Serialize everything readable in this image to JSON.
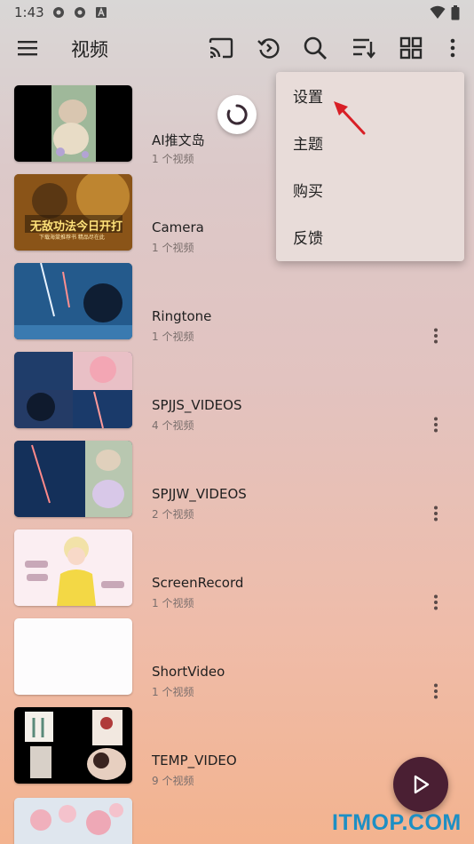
{
  "status_bar": {
    "time": "1:43",
    "icons": [
      "settings-gear-icon",
      "settings-gear-icon",
      "a-badge-icon"
    ],
    "right_icons": [
      "wifi-icon",
      "battery-icon"
    ]
  },
  "app_bar": {
    "title": "视频",
    "icons": [
      "menu-icon",
      "cast-icon",
      "history-icon",
      "search-icon",
      "sort-icon",
      "grid-view-icon",
      "more-vert-icon"
    ]
  },
  "menu": {
    "items": [
      {
        "label": "设置"
      },
      {
        "label": "主题"
      },
      {
        "label": "购买"
      },
      {
        "label": "反馈"
      }
    ]
  },
  "folders": [
    {
      "name": "AI推文岛",
      "count": "1 个视频"
    },
    {
      "name": "Camera",
      "count": "1 个视频"
    },
    {
      "name": "Ringtone",
      "count": "1 个视频"
    },
    {
      "name": "SPJJS_VIDEOS",
      "count": "4 个视频"
    },
    {
      "name": "SPJJW_VIDEOS",
      "count": "2 个视频"
    },
    {
      "name": "ScreenRecord",
      "count": "1 个视频"
    },
    {
      "name": "ShortVideo",
      "count": "1 个视频"
    },
    {
      "name": "TEMP_VIDEO",
      "count": "9 个视频"
    },
    {
      "name": "",
      "count": ""
    }
  ],
  "thumb_texts": {
    "camera_banner": "无敌功法今日开打",
    "camera_sub": "下载海棠推荐书 精品尽在此"
  },
  "colors": {
    "fab": "#4a1f33",
    "watermark": "#1d8fc4",
    "arrow": "#d81f26"
  },
  "watermark": "ITMOP.COM"
}
